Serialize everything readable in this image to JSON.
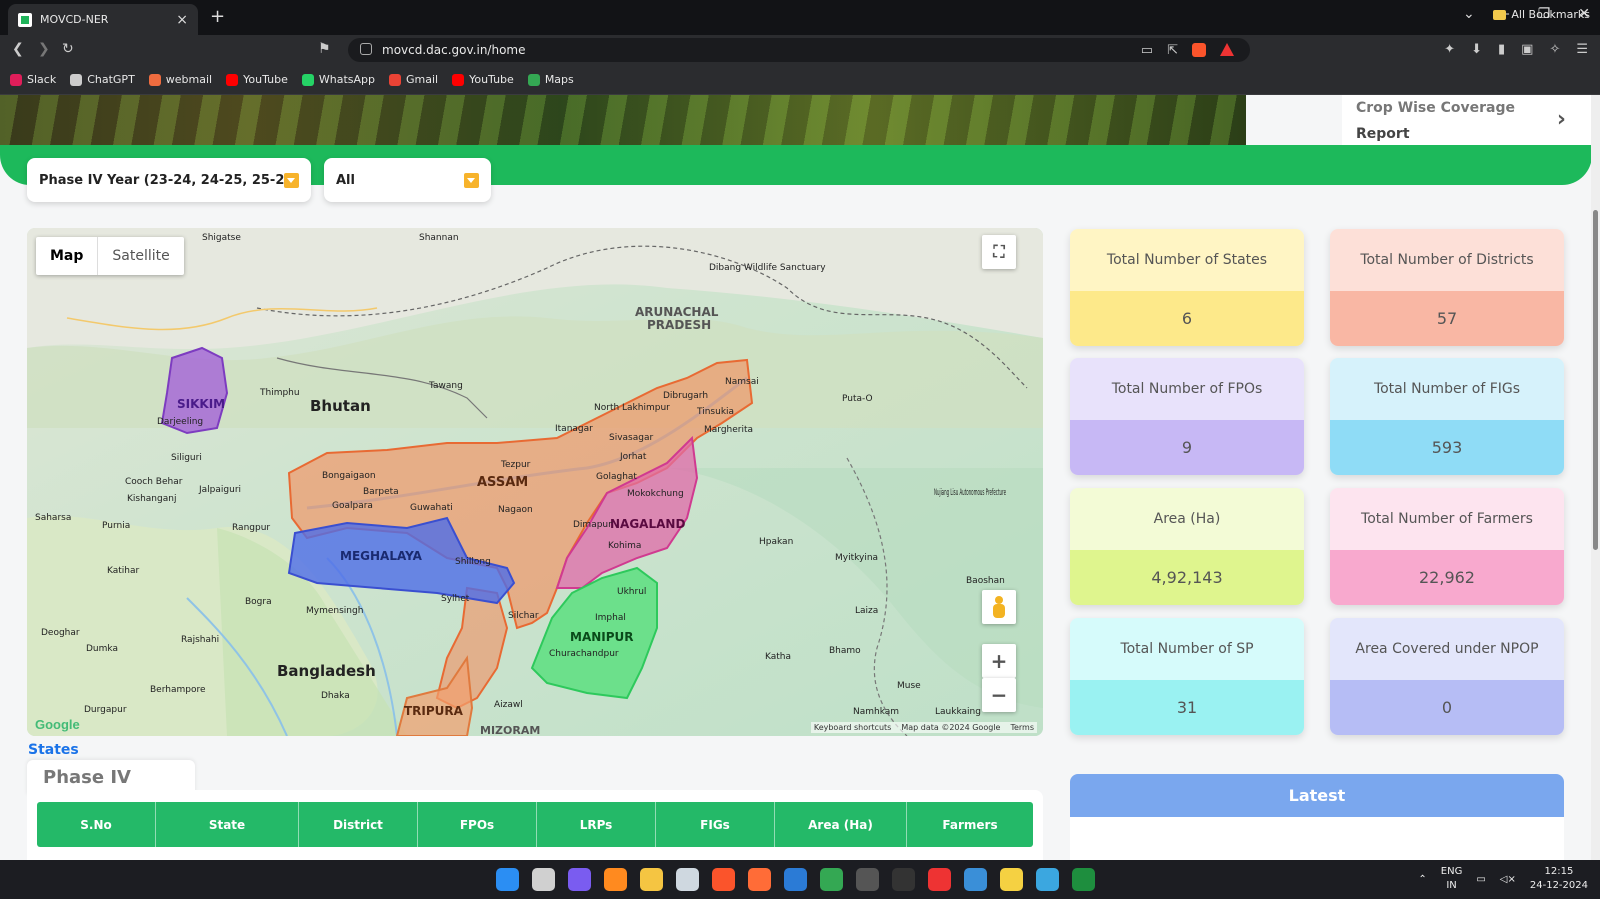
{
  "browser": {
    "tab_title": "MOVCD-NER",
    "url": "movcd.dac.gov.in/home",
    "bookmarks": [
      {
        "label": "Slack",
        "color": "#e01e5a"
      },
      {
        "label": "ChatGPT",
        "color": "#cccccc"
      },
      {
        "label": "webmail",
        "color": "#ef6c3f"
      },
      {
        "label": "YouTube",
        "color": "#ff0000"
      },
      {
        "label": "WhatsApp",
        "color": "#25d366"
      },
      {
        "label": "Gmail",
        "color": "#ea4335"
      },
      {
        "label": "YouTube",
        "color": "#ff0000"
      },
      {
        "label": "Maps",
        "color": "#34a853"
      }
    ],
    "all_bookmarks": "All Bookmarks"
  },
  "header": {
    "crop_report_line1": "Crop Wise Coverage",
    "crop_report_line2": "Report"
  },
  "filters": {
    "phase": "Phase IV Year (23-24, 24-25, 25-26)",
    "state": "All"
  },
  "map": {
    "toggle_map": "Map",
    "toggle_satellite": "Satellite",
    "states": [
      "SIKKIM",
      "ASSAM",
      "MEGHALAYA",
      "NAGALAND",
      "MANIPUR",
      "TRIPURA",
      "MIZORAM",
      "ARUNACHAL PRADESH"
    ],
    "labels": {
      "bhutan": "Bhutan",
      "bangladesh": "Bangladesh",
      "arunachal1": "ARUNACHAL",
      "arunachal2": "PRADESH",
      "sikkim": "SIKKIM",
      "assam": "ASSAM",
      "meghalaya": "MEGHALAYA",
      "nagaland": "NAGALAND",
      "manipur": "MANIPUR",
      "tripura": "TRIPURA",
      "mizoram": "MIZORAM",
      "thimphu": "Thimphu",
      "guwahati": "Guwahati",
      "shillong": "Shillong",
      "dhaka": "Dhaka",
      "imphal": "Imphal",
      "kohima": "Kohima",
      "tezpur": "Tezpur",
      "dibrugarh": "Dibrugarh",
      "tinsukia": "Tinsukia",
      "nagaon": "Nagaon",
      "silchar": "Silchar",
      "sylhet": "Sylhet",
      "dimapur": "Dimapur",
      "mokokchung": "Mokokchung",
      "jorhat": "Jorhat",
      "siliguri": "Siliguri",
      "bongaigaon": "Bongaigaon",
      "barpeta": "Barpeta",
      "goalpara": "Goalpara",
      "mymensingh": "Mymensingh",
      "rajshahi": "Rajshahi",
      "bogra": "Bogra",
      "aizawl": "Aizawl",
      "churachandpur": "Churachandpur",
      "ukhrul": "Ukhrul",
      "shigatse": "Shigatse",
      "shannan": "Shannan",
      "tawang": "Tawang",
      "myitkyina": "Myitkyina",
      "baoshan": "Baoshan",
      "laiza": "Laiza",
      "bhamo": "Bhamo",
      "katha": "Katha",
      "muse": "Muse",
      "hpakan": "Hpakan",
      "putao": "Puta-O",
      "namsai": "Namsai",
      "margherita": "Margherita",
      "sivasagar": "Sivasagar",
      "golaghat": "Golaghat",
      "itanagar": "Itanagar",
      "lakhimpur": "North Lakhimpur",
      "cooch": "Cooch Behar",
      "jalpaiguri": "Jalpaiguri",
      "kishanganj": "Kishanganj",
      "purnia": "Purnia",
      "katihar": "Katihar",
      "rangpur": "Rangpur",
      "dumka": "Dumka",
      "deoghar": "Deoghar",
      "berhampore": "Berhampore",
      "durgapur": "Durgapur",
      "saharsa": "Saharsa",
      "dibang": "Dibang Wildlife Sanctuary",
      "nujiang": "Nujiang Lisu Autonomous Prefecture",
      "darjeeling": "Darjeeling",
      "namhkam": "Namhkam",
      "laukkaing": "Laukkaing"
    },
    "footer_shortcuts": "Keyboard shortcuts",
    "footer_data": "Map data ©2024 Google",
    "footer_terms": "Terms",
    "google": "Google"
  },
  "stats": [
    {
      "label": "Total Number of States",
      "value": "6",
      "top": "#fff5c4",
      "bottom": "#fde98a"
    },
    {
      "label": "Total Number of Districts",
      "value": "57",
      "top": "#fde0d8",
      "bottom": "#f9b7a4"
    },
    {
      "label": "Total Number of FPOs",
      "value": "9",
      "top": "#e8e2fb",
      "bottom": "#c7b8f5"
    },
    {
      "label": "Total Number of FIGs",
      "value": "593",
      "top": "#d6f2fb",
      "bottom": "#8fdcf6"
    },
    {
      "label": "Area (Ha)",
      "value": "4,92,143",
      "top": "#f3fbd6",
      "bottom": "#dff58e"
    },
    {
      "label": "Total Number of Farmers",
      "value": "22,962",
      "top": "#fde4ef",
      "bottom": "#f8a9ce"
    },
    {
      "label": "Total Number of SP",
      "value": "31",
      "top": "#d6fbfb",
      "bottom": "#9af2f2"
    },
    {
      "label": "Area Covered under NPOP",
      "value": "0",
      "top": "#e3e6fb",
      "bottom": "#b6bdf5"
    }
  ],
  "states_section": {
    "link": "States",
    "phase_tab": "Phase IV",
    "columns": [
      "S.No",
      "State",
      "District",
      "FPOs",
      "LRPs",
      "FIGs",
      "Area (Ha)",
      "Farmers"
    ]
  },
  "latest": {
    "title": "Latest"
  },
  "taskbar": {
    "lang1": "ENG",
    "lang2": "IN",
    "time": "12:15",
    "date": "24-12-2024"
  }
}
